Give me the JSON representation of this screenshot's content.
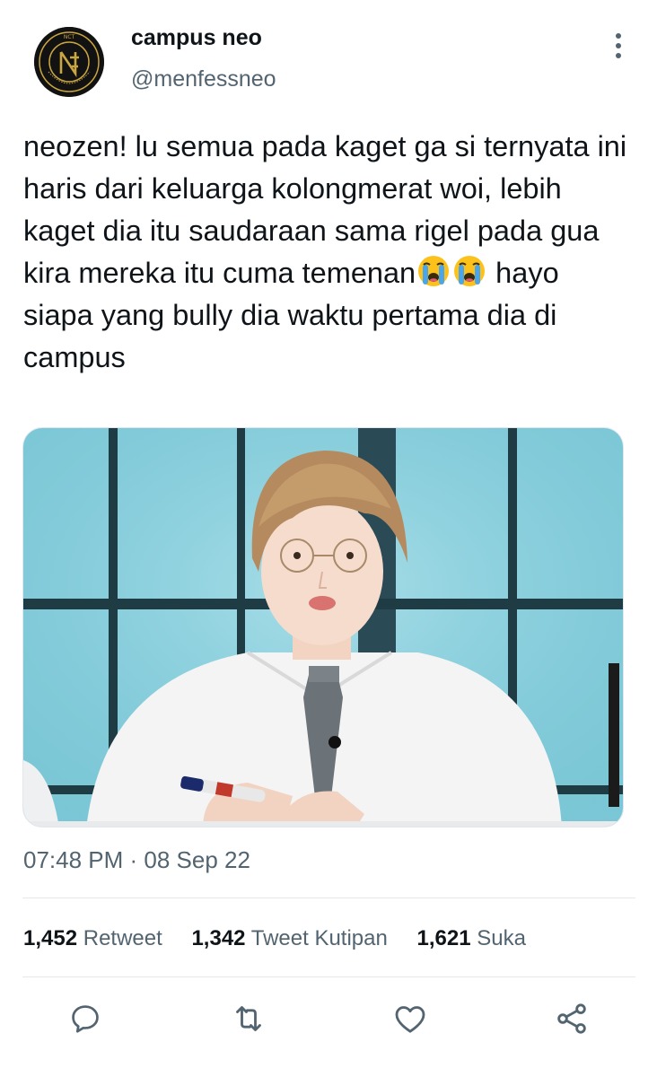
{
  "account": {
    "name": "campus neo",
    "handle": "@menfessneo",
    "avatar_icon": "nct-logo-avatar",
    "avatar_logo_text": "NCT",
    "avatar_ring_text": "NEO CULTURE TECHNOLOGY"
  },
  "tweet": {
    "text_part1": "neozen! lu semua pada kaget ga si ternyata ini haris dari keluarga kolongmerat woi, lebih kaget dia itu saudaraan sama rigel pada gua kira mereka itu cuma temenan",
    "emoji": "loudly-crying-face",
    "text_part2": " hayo siapa yang bully dia waktu pertama dia di campus",
    "media_icon": "photo-person-glasses-white-shirt"
  },
  "meta": {
    "timestamp": "07:48 PM · 08 Sep 22"
  },
  "stats": {
    "retweet_count": "1,452",
    "retweet_label": "Retweet",
    "quote_count": "1,342",
    "quote_label": "Tweet Kutipan",
    "like_count": "1,621",
    "like_label": "Suka"
  },
  "actions": {
    "reply_icon": "reply-icon",
    "retweet_icon": "retweet-icon",
    "like_icon": "heart-icon",
    "share_icon": "share-icon"
  },
  "colors": {
    "text_primary": "#0f1419",
    "text_secondary": "#536471",
    "divider": "#e6e9eb",
    "window_blue": "#7ec7d8"
  }
}
